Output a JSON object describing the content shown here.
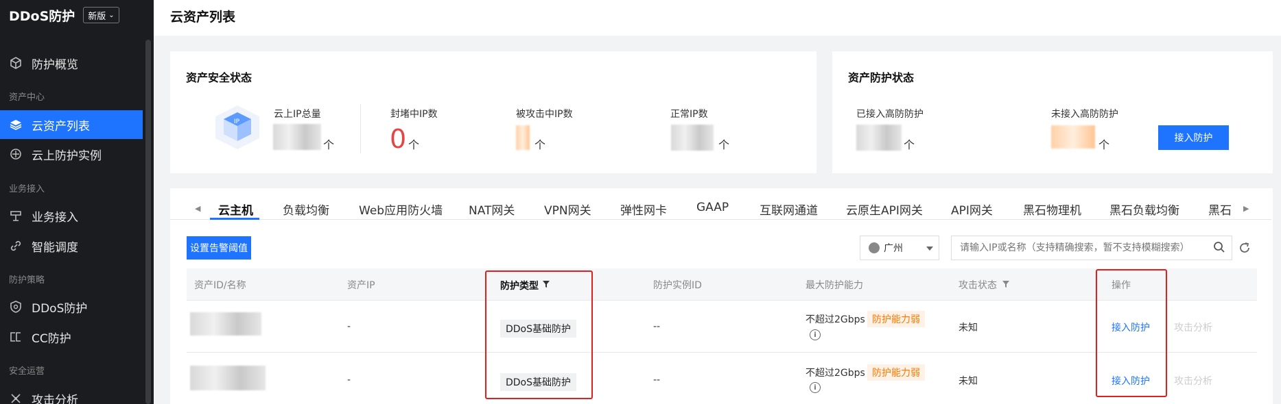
{
  "sidebar": {
    "title": "DDoS防护",
    "version": "新版",
    "groups": [
      "资产中心",
      "业务接入",
      "防护策略",
      "安全运营"
    ],
    "items": [
      {
        "label": "防护概览",
        "icon": "cube-icon"
      },
      {
        "label": "云资产列表",
        "icon": "layers-icon",
        "active": true
      },
      {
        "label": "云上防护实例",
        "icon": "shield-cloud-icon"
      },
      {
        "label": "业务接入",
        "icon": "plug-icon"
      },
      {
        "label": "智能调度",
        "icon": "link-icon"
      },
      {
        "label": "DDoS防护",
        "icon": "shield-icon"
      },
      {
        "label": "CC防护",
        "icon": "cc-icon"
      },
      {
        "label": "攻击分析",
        "icon": "scatter-icon"
      }
    ]
  },
  "header": {
    "title": "云资产列表"
  },
  "security_card": {
    "title": "资产安全状态",
    "stats": [
      {
        "label": "云上IP总量",
        "unit": "个"
      },
      {
        "label": "封堵中IP数",
        "value": "0",
        "unit": "个"
      },
      {
        "label": "被攻击中IP数",
        "unit": "个"
      },
      {
        "label": "正常IP数",
        "unit": "个"
      }
    ]
  },
  "protection_card": {
    "title": "资产防护状态",
    "stats": [
      {
        "label": "已接入高防防护",
        "unit": "个"
      },
      {
        "label": "未接入高防防护",
        "unit": "个"
      }
    ],
    "button": "接入防护"
  },
  "tabs": [
    "云主机",
    "负载均衡",
    "Web应用防火墙",
    "NAT网关",
    "VPN网关",
    "弹性网卡",
    "GAAP",
    "互联网通道",
    "云原生API网关",
    "API网关",
    "黑石物理机",
    "黑石负载均衡",
    "黑石"
  ],
  "toolbar": {
    "alert_button": "设置告警阈值",
    "region": "广州",
    "search_placeholder": "请输入IP或名称（支持精确搜索，暂不支持模糊搜索）"
  },
  "table": {
    "columns": [
      "资产ID/名称",
      "资产IP",
      "防护类型",
      "防护实例ID",
      "最大防护能力",
      "攻击状态",
      "操作"
    ],
    "rows": [
      {
        "ip": "-",
        "type": "DDoS基础防护",
        "instance": "--",
        "capacity": "不超过2Gbps",
        "capacity_tag": "防护能力弱",
        "status": "未知",
        "action": "接入防护",
        "action2": "攻击分析"
      },
      {
        "ip": "-",
        "type": "DDoS基础防护",
        "instance": "--",
        "capacity": "不超过2Gbps",
        "capacity_tag": "防护能力弱",
        "status": "未知",
        "action": "接入防护",
        "action2": "攻击分析"
      }
    ]
  },
  "colors": {
    "accent": "#1e74ff",
    "danger": "#e54545",
    "warn": "#ff7a00",
    "annotation": "#e02020"
  }
}
